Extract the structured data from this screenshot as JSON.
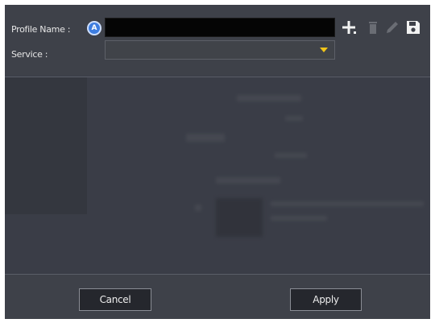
{
  "form": {
    "profile_name_label": "Profile Name :",
    "profile_name_value": "",
    "auto_badge": "A",
    "service_label": "Service :",
    "service_selected": ""
  },
  "toolbar": {
    "icons": [
      "add-icon",
      "delete-icon",
      "edit-icon",
      "save-icon"
    ]
  },
  "buttons": {
    "cancel_label": "Cancel",
    "apply_label": "Apply"
  },
  "colors": {
    "dialog_bg": "#3a3d47",
    "input_bg": "#050505",
    "accent_blue": "#3d7de0",
    "dropdown_arrow": "#f0c419"
  }
}
